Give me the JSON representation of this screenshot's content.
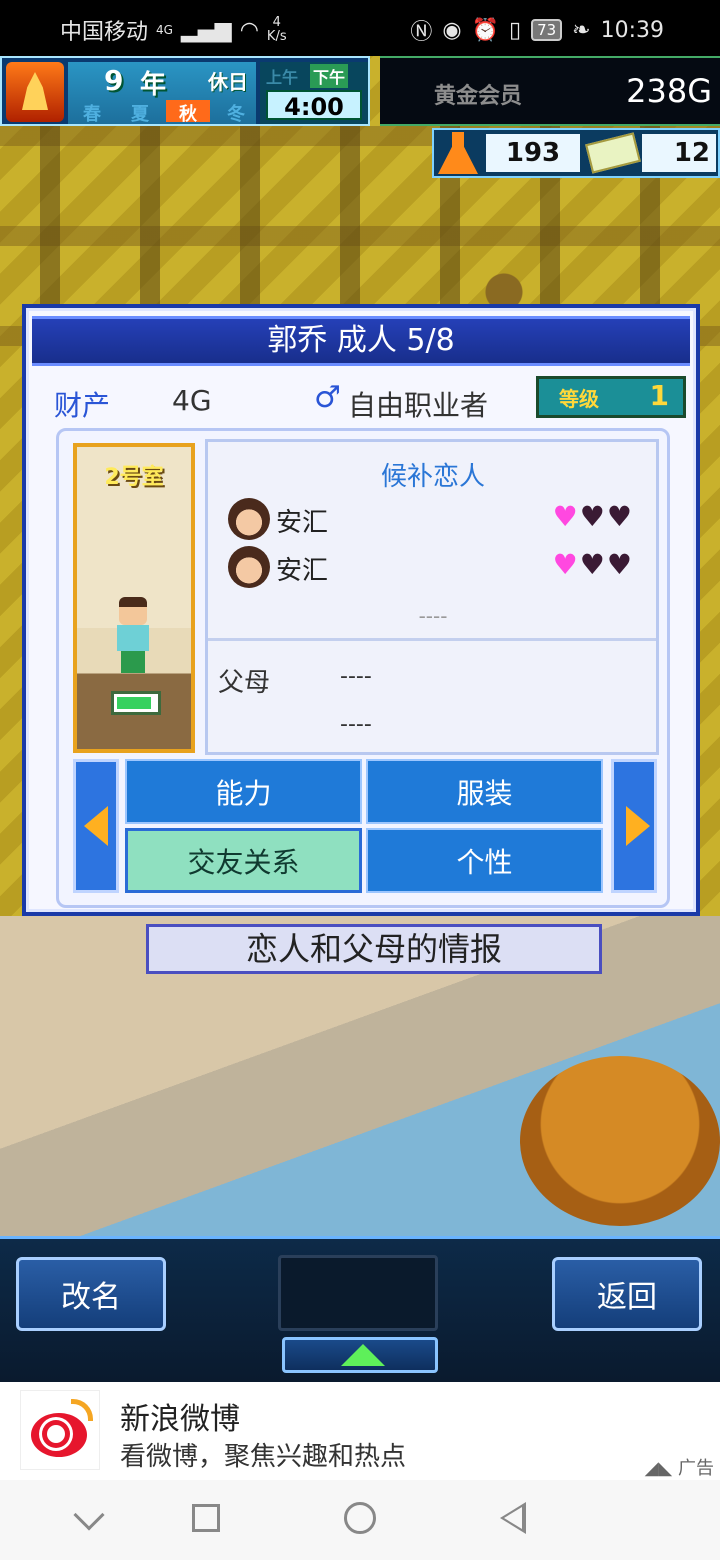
{
  "status_bar": {
    "carrier": "中国移动",
    "network": "4G",
    "speed_value": "4",
    "speed_unit": "K/s",
    "battery": "73",
    "time": "10:39"
  },
  "hud": {
    "year": "9",
    "year_unit": "年",
    "day_label": "休日",
    "seasons": [
      "春",
      "夏",
      "秋",
      "冬"
    ],
    "active_season": "秋",
    "am_label": "上午",
    "pm_label": "下午",
    "clock": "4:00",
    "membership": "黄金会员",
    "gold": "238G",
    "research_points": "193",
    "tickets": "12"
  },
  "dialog": {
    "title": "郭乔 成人 5/8",
    "asset_label": "财产",
    "asset_value": "4G",
    "gender_icon": "male-icon",
    "job": "自由职业者",
    "level_label": "等级",
    "level_value": "1",
    "room": "2号室",
    "candidate_title": "候补恋人",
    "lovers": [
      {
        "name": "安汇",
        "hearts_filled": 1,
        "hearts_total": 3
      },
      {
        "name": "安汇",
        "hearts_filled": 1,
        "hearts_total": 3
      }
    ],
    "candidate_empty": "----",
    "parents_label": "父母",
    "parents": [
      "----",
      "----"
    ],
    "tabs": [
      "能力",
      "服装",
      "交友关系",
      "个性"
    ],
    "active_tab": "交友关系",
    "caption": "恋人和父母的情报"
  },
  "controls": {
    "rename": "改名",
    "back": "返回"
  },
  "ad": {
    "title": "新浪微博",
    "subtitle": "看微博，聚焦兴趣和热点",
    "tag": "广告"
  },
  "colors": {
    "dialog_border": "#1a3aa8",
    "tab_blue": "#1f7ad8",
    "tab_active": "#8fe0c0",
    "heart_on": "#ff48e0",
    "heart_off": "#3a1a34",
    "accent_text": "#2a76d6"
  }
}
